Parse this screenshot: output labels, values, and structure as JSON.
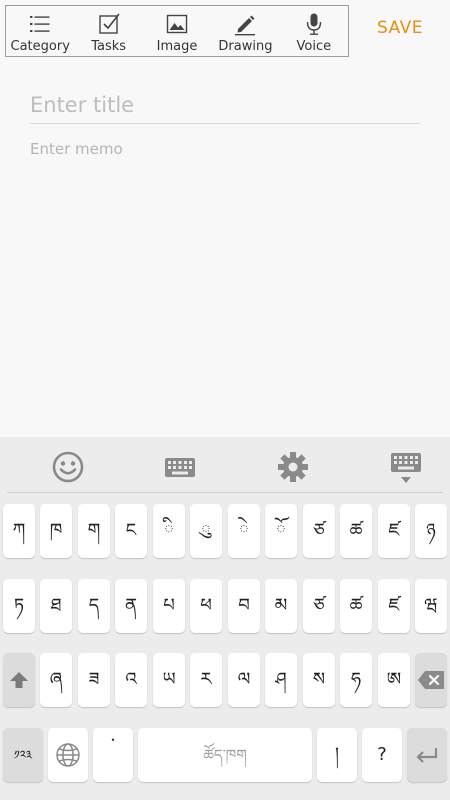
{
  "toolbar": {
    "items": [
      {
        "label": "Category",
        "icon": "list-icon"
      },
      {
        "label": "Tasks",
        "icon": "checkbox-icon"
      },
      {
        "label": "Image",
        "icon": "image-icon"
      },
      {
        "label": "Drawing",
        "icon": "pencil-icon"
      },
      {
        "label": "Voice",
        "icon": "microphone-icon"
      }
    ],
    "save_label": "SAVE",
    "accent": "#e5900a"
  },
  "editor": {
    "title_placeholder": "Enter title",
    "memo_placeholder": "Enter memo"
  },
  "keyboard": {
    "top_icons": [
      "emoji-icon",
      "keyboard-icon",
      "settings-icon",
      "hide-keyboard-icon"
    ],
    "row1": [
      "ཀ",
      "ཁ",
      "ག",
      "ང",
      "ི",
      "ུ",
      "ེ",
      "ོ",
      "ཙ",
      "ཚ",
      "ཛ",
      "ཉ"
    ],
    "row2": [
      "ཏ",
      "ཐ",
      "ད",
      "ན",
      "པ",
      "ཕ",
      "བ",
      "མ",
      "ཙ",
      "ཚ",
      "ཛ",
      "ཝ"
    ],
    "row3": [
      "ཞ",
      "ཟ",
      "འ",
      "ཡ",
      "ར",
      "ལ",
      "ཤ",
      "ས",
      "ཧ",
      "ཨ"
    ],
    "symbols_label": "༡༢༣",
    "tsheg": "་",
    "space_label": "ཚོད་ཁག",
    "shad": "།",
    "question": "?"
  }
}
